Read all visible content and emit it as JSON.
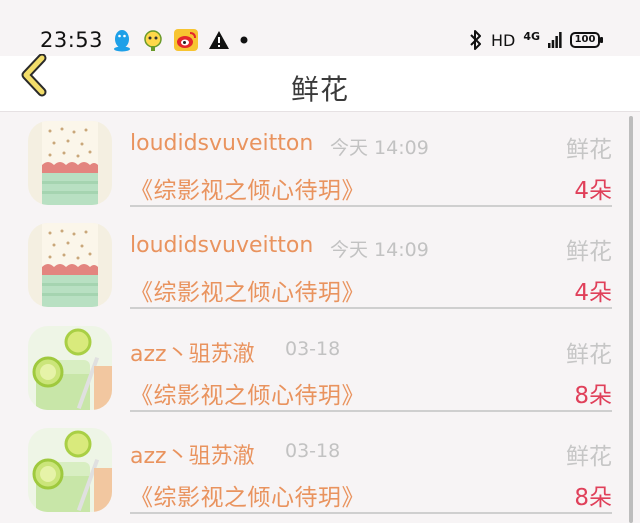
{
  "status_bar": {
    "time": "23:53",
    "icons_left": [
      "qq-icon",
      "emoji-app-icon",
      "weibo-icon",
      "warning-icon",
      "dot-icon"
    ],
    "network": "HD",
    "network_type": "4G",
    "battery": "100"
  },
  "header": {
    "title": "鲜花",
    "back_icon": "chevron-left-icon",
    "accent": "#f2dd6a"
  },
  "colors": {
    "name": "#e9935e",
    "time": "#c2c2c2",
    "type": "#c6c6c6",
    "count": "#e0405a"
  },
  "records": [
    {
      "avatar": "phone-case-avatar",
      "name": "loudidsvuveitton",
      "time": "今天 14:09",
      "type": "鲜花",
      "book": "《综影视之倾心待玥》",
      "count": "4朵"
    },
    {
      "avatar": "phone-case-avatar",
      "name": "loudidsvuveitton",
      "time": "今天 14:09",
      "type": "鲜花",
      "book": "《综影视之倾心待玥》",
      "count": "4朵"
    },
    {
      "avatar": "lime-drink-avatar",
      "name": "azz丶驵苏澈",
      "time": "03-18",
      "type": "鲜花",
      "book": "《综影视之倾心待玥》",
      "count": "8朵"
    },
    {
      "avatar": "lime-drink-avatar",
      "name": "azz丶驵苏澈",
      "time": "03-18",
      "type": "鲜花",
      "book": "《综影视之倾心待玥》",
      "count": "8朵"
    }
  ]
}
